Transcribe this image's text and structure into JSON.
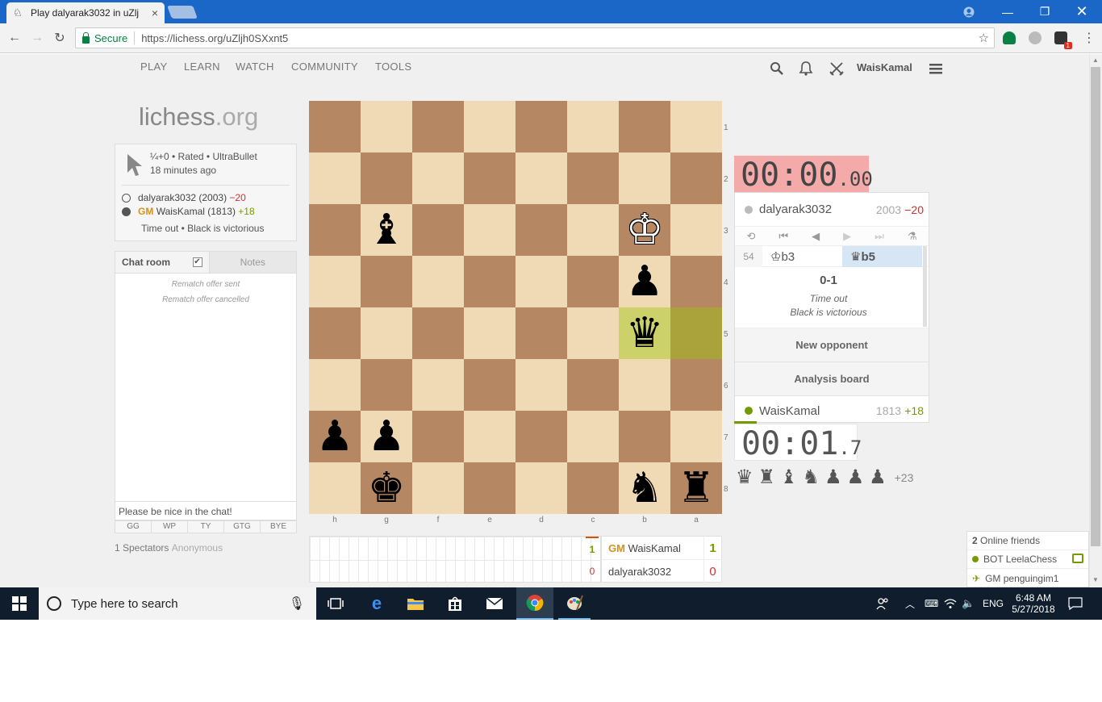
{
  "browser": {
    "tab_title": "Play dalyarak3032 in uZlj",
    "url_secure": "Secure",
    "url": "https://lichess.org/uZljh0SXxnt5",
    "ext_badge": "1"
  },
  "nav": {
    "items": [
      "PLAY",
      "LEARN",
      "WATCH",
      "COMMUNITY",
      "TOOLS"
    ],
    "username": "WaisKamal"
  },
  "logo": {
    "main": "lichess",
    "suffix": ".org"
  },
  "game": {
    "setup": "¼+0 • Rated • UltraBullet",
    "when": "18 minutes ago",
    "white": {
      "name": "dalyarak3032 (2003)",
      "diff": "−20"
    },
    "black": {
      "title": "GM",
      "name": "WaisKamal (1813)",
      "diff": "+18"
    },
    "status": "Time out • Black is victorious"
  },
  "chat": {
    "tab_chat": "Chat room",
    "tab_notes": "Notes",
    "check": "✔",
    "messages": [
      "Rematch offer sent",
      "Rematch offer cancelled"
    ],
    "input_placeholder": "Please be nice in the chat!",
    "presets": [
      "GG",
      "WP",
      "TY",
      "GTG",
      "BYE"
    ]
  },
  "spectators": {
    "count_label": "1 Spectators",
    "names": "Anonymous"
  },
  "board": {
    "ranks": [
      "1",
      "2",
      "3",
      "4",
      "5",
      "6",
      "7",
      "8"
    ],
    "files": [
      "h",
      "g",
      "f",
      "e",
      "d",
      "c",
      "b",
      "a"
    ],
    "pieces": {
      "g3": "♝",
      "b3": "♔",
      "b4": "♟",
      "b5": "♛",
      "h7": "♟",
      "g7": "♟",
      "g8": "♚",
      "b8": "♞",
      "a8": "♜"
    }
  },
  "clocks": {
    "top_main": "00:00",
    "top_frac": ".00",
    "bottom_main": "00:01",
    "bottom_frac": ".7"
  },
  "panel": {
    "top_player": {
      "name": "dalyarak3032",
      "rating": "2003",
      "diff": "−20"
    },
    "move_number": "54",
    "move_white": "♔b3",
    "move_black": "♛b5",
    "result_score": "0-1",
    "result_reason": "Time out",
    "result_winner": "Black is victorious",
    "btn_new_opponent": "New opponent",
    "btn_analysis": "Analysis board",
    "bottom_player": {
      "name": "WaisKamal",
      "rating": "1813",
      "diff": "+18"
    }
  },
  "material": {
    "pieces": [
      "♛",
      "♜",
      "♝",
      "♞",
      "♟",
      "♟",
      "♟"
    ],
    "diff": "+23"
  },
  "crosstable": {
    "last_game_top": "1",
    "last_game_bottom": "0",
    "p1_title": "GM",
    "p1_name": "WaisKamal",
    "p1_score": "1",
    "p2_name": "dalyarak3032",
    "p2_score": "0"
  },
  "friends": {
    "count": "2",
    "label": "Online friends",
    "list": [
      {
        "name": "BOT LeelaChess"
      },
      {
        "name": "GM penguingim1"
      }
    ]
  },
  "taskbar": {
    "search_placeholder": "Type here to search",
    "lang": "ENG",
    "time": "6:48 AM",
    "date": "5/27/2018"
  },
  "colors": {
    "chrome_blue": "#1a67c7",
    "light_square": "#f0d9b5",
    "dark_square": "#b58863",
    "last_move": "#cdd16a",
    "clock_low": "#f3aaa9",
    "good": "#759900",
    "bad": "#cc3333",
    "gm_orange": "#d59120"
  }
}
